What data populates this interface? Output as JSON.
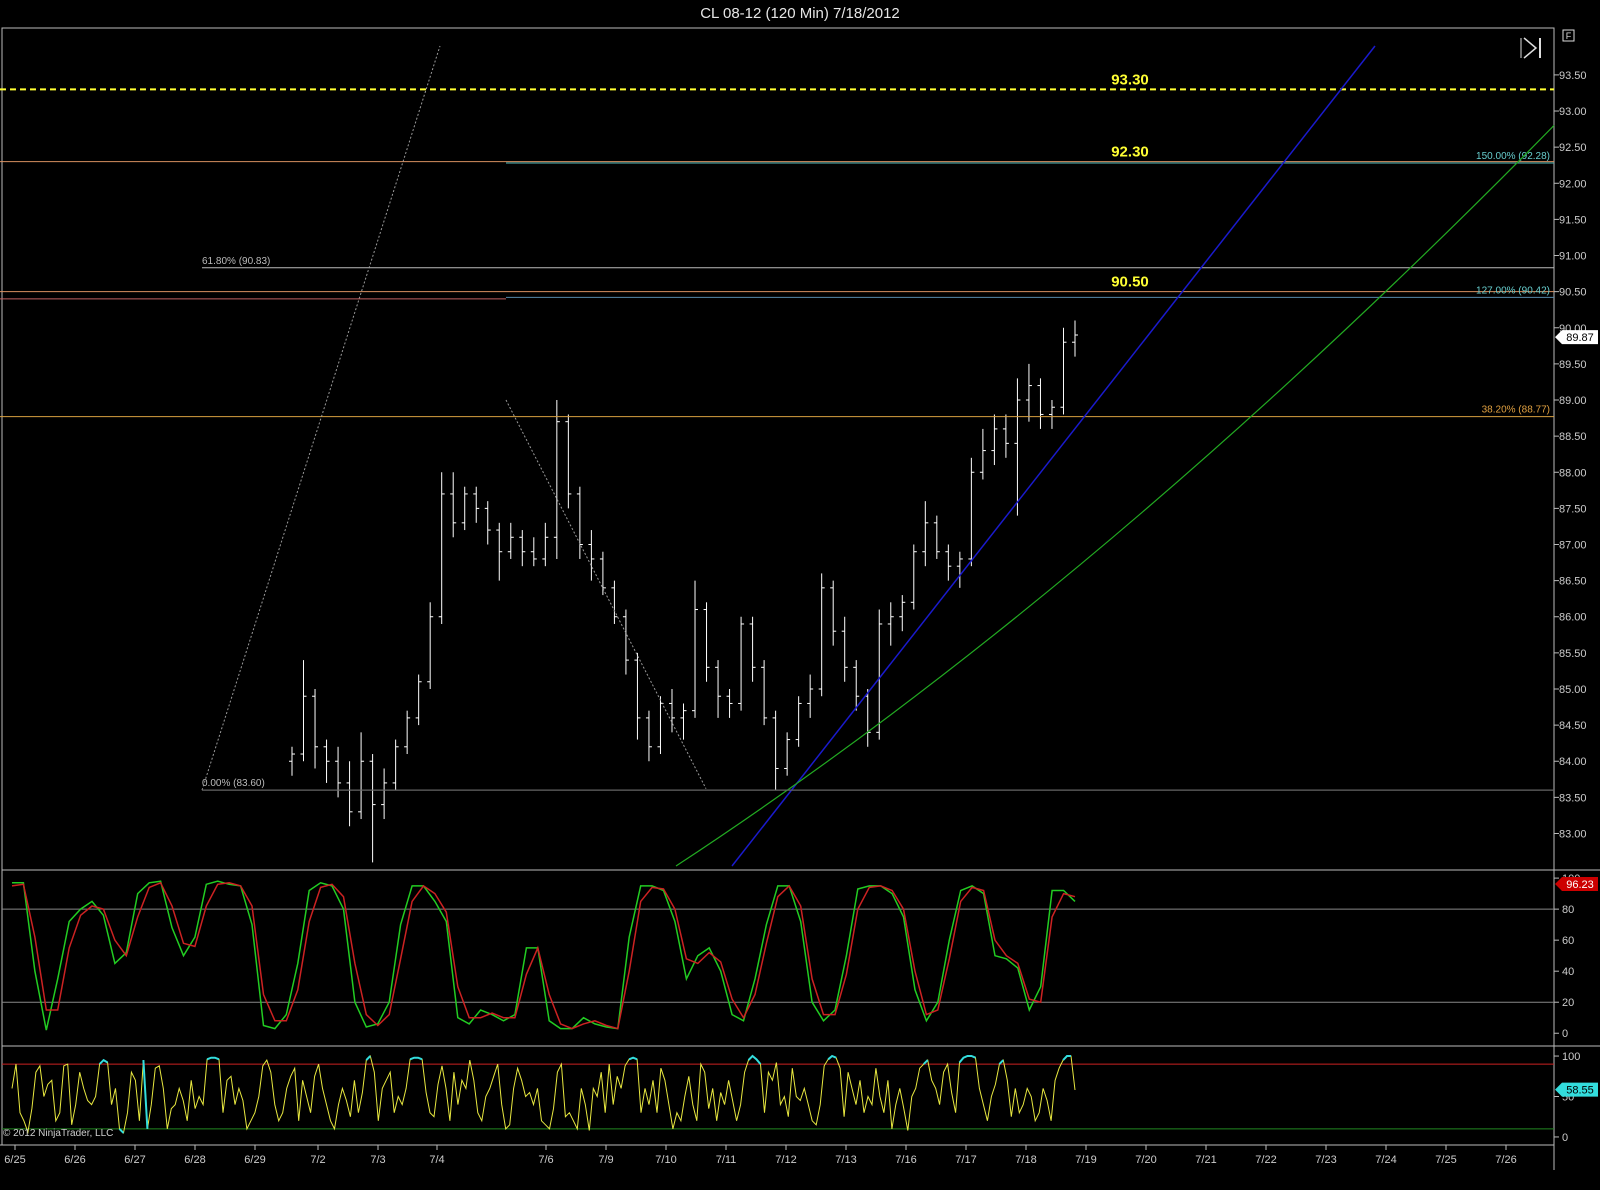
{
  "title": "CL 08-12 (120 Min)  7/18/2012",
  "copyright": "© 2012 NinjaTrader, LLC",
  "colors": {
    "background": "#000000",
    "grid": "#8a8a8a",
    "candles": "#ffffff",
    "yellow_level": "#ffff33",
    "fib_line": "#b0b0b0",
    "stoch_k": "#22cc22",
    "stoch_d": "#cc2222",
    "lower_line": "#e8e840",
    "lower_hi": "#33dddd",
    "blue_trend": "#1a1acc",
    "green_trend": "#22aa22",
    "price_marker": "#ffffff",
    "stoch_marker": "#cc0000",
    "lower_marker": "#33dddd"
  },
  "toolbar": {
    "icon": "scroll-end-icon",
    "f_label": "F"
  },
  "chart_data": [
    {
      "type": "candlestick",
      "title": "CL 08-12 (120 Min)  7/18/2012",
      "ylim": [
        82.55,
        93.9
      ],
      "yticks": [
        83.0,
        83.5,
        84.0,
        84.5,
        85.0,
        85.5,
        86.0,
        86.5,
        87.0,
        87.5,
        88.0,
        88.5,
        89.0,
        89.5,
        90.0,
        90.5,
        91.0,
        91.5,
        92.0,
        92.5,
        93.0,
        93.5
      ],
      "ytick_labels": [
        "83.00",
        "83.50",
        "84.00",
        "84.50",
        "85.00",
        "85.50",
        "86.00",
        "86.50",
        "87.00",
        "87.50",
        "88.00",
        "88.50",
        "89.00",
        "89.50",
        "90.00",
        "90.50",
        "91.00",
        "91.50",
        "92.00",
        "92.50",
        "93.00",
        "93.50"
      ],
      "last_price": "89.87",
      "last_price_value": 89.87,
      "levels": [
        {
          "value": 93.3,
          "label": "93.30",
          "style": "dashed"
        },
        {
          "value": 92.3,
          "label": "92.30",
          "style": "solid"
        },
        {
          "value": 90.5,
          "label": "90.50",
          "style": "solid"
        }
      ],
      "fib_labels": [
        {
          "value": 90.83,
          "label": "61.80% (90.83)"
        },
        {
          "value": 83.6,
          "label": "0.00% (83.60)"
        },
        {
          "value": 88.77,
          "label": "38.20% (88.77)"
        },
        {
          "value": 92.28,
          "label": "150.00% (92.28)"
        },
        {
          "value": 90.42,
          "label": "127.00% (90.42)"
        }
      ],
      "ohlc": [
        [
          84.0,
          84.2,
          83.8,
          84.1
        ],
        [
          84.1,
          85.4,
          84.0,
          84.9
        ],
        [
          84.9,
          85.0,
          83.9,
          84.2
        ],
        [
          84.2,
          84.3,
          83.7,
          84.0
        ],
        [
          84.0,
          84.2,
          83.5,
          83.7
        ],
        [
          83.7,
          84.0,
          83.1,
          83.3
        ],
        [
          83.3,
          84.4,
          83.2,
          84.0
        ],
        [
          84.0,
          84.1,
          82.6,
          83.4
        ],
        [
          83.4,
          83.9,
          83.2,
          83.7
        ],
        [
          83.7,
          84.3,
          83.6,
          84.2
        ],
        [
          84.2,
          84.7,
          84.1,
          84.6
        ],
        [
          84.6,
          85.2,
          84.5,
          85.1
        ],
        [
          85.1,
          86.2,
          85.0,
          86.0
        ],
        [
          86.0,
          88.0,
          85.9,
          87.7
        ],
        [
          87.7,
          88.0,
          87.1,
          87.3
        ],
        [
          87.3,
          87.8,
          87.2,
          87.7
        ],
        [
          87.7,
          87.8,
          87.3,
          87.5
        ],
        [
          87.5,
          87.6,
          87.0,
          87.2
        ],
        [
          87.2,
          87.3,
          86.5,
          86.9
        ],
        [
          86.9,
          87.3,
          86.8,
          87.1
        ],
        [
          87.1,
          87.2,
          86.7,
          86.9
        ],
        [
          86.9,
          87.1,
          86.7,
          86.8
        ],
        [
          86.8,
          87.3,
          86.7,
          87.1
        ],
        [
          87.1,
          89.0,
          86.8,
          88.7
        ],
        [
          88.7,
          88.8,
          87.5,
          87.7
        ],
        [
          87.7,
          87.8,
          86.8,
          87.0
        ],
        [
          87.0,
          87.2,
          86.5,
          86.8
        ],
        [
          86.8,
          86.9,
          86.3,
          86.4
        ],
        [
          86.4,
          86.5,
          85.9,
          86.0
        ],
        [
          86.0,
          86.1,
          85.2,
          85.4
        ],
        [
          85.4,
          85.5,
          84.3,
          84.6
        ],
        [
          84.6,
          84.7,
          84.0,
          84.2
        ],
        [
          84.2,
          84.9,
          84.1,
          84.8
        ],
        [
          84.8,
          85.0,
          84.4,
          84.6
        ],
        [
          84.6,
          84.8,
          84.3,
          84.7
        ],
        [
          84.7,
          86.5,
          84.6,
          86.1
        ],
        [
          86.1,
          86.2,
          85.1,
          85.3
        ],
        [
          85.3,
          85.4,
          84.6,
          84.9
        ],
        [
          84.9,
          85.0,
          84.6,
          84.8
        ],
        [
          84.8,
          86.0,
          84.7,
          85.9
        ],
        [
          85.9,
          86.0,
          85.1,
          85.3
        ],
        [
          85.3,
          85.4,
          84.5,
          84.6
        ],
        [
          84.6,
          84.7,
          83.6,
          83.9
        ],
        [
          83.9,
          84.4,
          83.8,
          84.3
        ],
        [
          84.3,
          84.9,
          84.2,
          84.8
        ],
        [
          84.8,
          85.2,
          84.6,
          85.0
        ],
        [
          85.0,
          86.6,
          84.9,
          86.4
        ],
        [
          86.4,
          86.5,
          85.6,
          85.8
        ],
        [
          85.8,
          86.0,
          85.1,
          85.3
        ],
        [
          85.3,
          85.4,
          84.7,
          84.9
        ],
        [
          84.9,
          85.0,
          84.2,
          84.4
        ],
        [
          84.4,
          86.1,
          84.3,
          85.9
        ],
        [
          85.9,
          86.2,
          85.6,
          86.0
        ],
        [
          86.0,
          86.3,
          85.8,
          86.2
        ],
        [
          86.2,
          87.0,
          86.1,
          86.9
        ],
        [
          86.9,
          87.6,
          86.7,
          87.3
        ],
        [
          87.3,
          87.4,
          86.8,
          86.9
        ],
        [
          86.9,
          87.0,
          86.5,
          86.7
        ],
        [
          86.7,
          86.9,
          86.4,
          86.8
        ],
        [
          86.8,
          88.2,
          86.7,
          88.0
        ],
        [
          88.0,
          88.6,
          87.9,
          88.3
        ],
        [
          88.3,
          88.8,
          88.1,
          88.6
        ],
        [
          88.6,
          88.8,
          88.2,
          88.4
        ],
        [
          88.4,
          89.3,
          87.4,
          89.0
        ],
        [
          89.0,
          89.5,
          88.7,
          89.2
        ],
        [
          89.2,
          89.3,
          88.6,
          88.8
        ],
        [
          88.8,
          89.0,
          88.6,
          88.9
        ],
        [
          88.9,
          90.0,
          88.8,
          89.8
        ],
        [
          89.8,
          90.1,
          89.6,
          89.9
        ]
      ]
    },
    {
      "type": "line",
      "ylim": [
        -5,
        102
      ],
      "yticks": [
        0,
        20,
        40,
        60,
        80,
        100
      ],
      "ytick_labels": [
        "0",
        "20",
        "40",
        "60",
        "80",
        "100"
      ],
      "hlines": [
        20,
        80
      ],
      "last_value": "96.23",
      "series": [
        {
          "values": [
            97,
            97,
            40,
            2,
            35,
            72,
            80,
            85,
            76,
            45,
            52,
            90,
            97,
            98,
            68,
            50,
            62,
            96,
            98,
            96,
            95,
            70,
            5,
            3,
            12,
            45,
            92,
            97,
            95,
            80,
            20,
            4,
            6,
            20,
            70,
            95,
            95,
            85,
            72,
            10,
            6,
            15,
            12,
            8,
            12,
            55,
            55,
            8,
            3,
            3,
            10,
            6,
            4,
            3,
            62,
            95,
            95,
            92,
            72,
            35,
            50,
            55,
            40,
            12,
            8,
            35,
            70,
            95,
            95,
            72,
            20,
            8,
            15,
            50,
            93,
            95,
            95,
            90,
            75,
            28,
            8,
            20,
            60,
            92,
            95,
            90,
            50,
            48,
            42,
            15,
            30,
            92,
            92,
            85
          ]
        },
        {
          "values": [
            95,
            96,
            62,
            15,
            15,
            55,
            76,
            82,
            80,
            60,
            50,
            75,
            94,
            97,
            82,
            58,
            56,
            82,
            96,
            97,
            95,
            82,
            25,
            8,
            8,
            28,
            72,
            94,
            96,
            88,
            45,
            12,
            5,
            12,
            48,
            85,
            95,
            90,
            78,
            30,
            10,
            10,
            13,
            10,
            10,
            38,
            55,
            25,
            6,
            3,
            6,
            8,
            5,
            3,
            40,
            85,
            94,
            93,
            80,
            48,
            45,
            52,
            46,
            22,
            10,
            25,
            58,
            88,
            95,
            82,
            35,
            12,
            12,
            38,
            80,
            94,
            95,
            92,
            80,
            40,
            12,
            15,
            48,
            85,
            94,
            92,
            60,
            50,
            45,
            22,
            20,
            75,
            90,
            88
          ]
        }
      ]
    },
    {
      "type": "line",
      "ylim": [
        -5,
        105
      ],
      "yticks": [
        0,
        50,
        100
      ],
      "ytick_labels": [
        "0",
        "50",
        "100"
      ],
      "hlines": [
        10,
        90
      ],
      "last_value": "58.55",
      "series": [
        {
          "values": [
            60,
            90,
            30,
            20,
            6,
            35,
            80,
            88,
            50,
            65,
            70,
            20,
            30,
            88,
            90,
            15,
            40,
            80,
            60,
            45,
            40,
            50,
            90,
            95,
            92,
            40,
            60,
            10,
            5,
            30,
            80,
            70,
            20,
            95,
            10,
            40,
            85,
            88,
            60,
            10,
            35,
            40,
            60,
            45,
            20,
            70,
            35,
            50,
            40,
            96,
            98,
            98,
            96,
            30,
            70,
            75,
            40,
            60,
            45,
            10,
            20,
            30,
            50,
            88,
            95,
            80,
            40,
            20,
            30,
            60,
            75,
            85,
            20,
            70,
            50,
            30,
            75,
            90,
            60,
            40,
            20,
            10,
            40,
            60,
            45,
            25,
            70,
            30,
            55,
            95,
            100,
            80,
            20,
            60,
            70,
            80,
            30,
            50,
            40,
            60,
            96,
            98,
            98,
            96,
            55,
            30,
            25,
            65,
            88,
            60,
            20,
            80,
            40,
            70,
            60,
            95,
            70,
            30,
            20,
            50,
            60,
            75,
            90,
            40,
            10,
            15,
            60,
            85,
            70,
            50,
            55,
            40,
            60,
            20,
            15,
            10,
            35,
            80,
            90,
            25,
            30,
            20,
            10,
            60,
            40,
            8,
            60,
            50,
            80,
            30,
            90,
            40,
            75,
            60,
            88,
            96,
            98,
            96,
            30,
            60,
            40,
            70,
            30,
            85,
            70,
            40,
            10,
            30,
            20,
            50,
            75,
            40,
            20,
            90,
            80,
            35,
            60,
            20,
            55,
            40,
            70,
            45,
            20,
            40,
            80,
            95,
            100,
            96,
            90,
            30,
            80,
            70,
            92,
            40,
            50,
            25,
            85,
            50,
            45,
            60,
            40,
            20,
            15,
            40,
            88,
            96,
            100,
            98,
            85,
            25,
            80,
            60,
            40,
            70,
            30,
            50,
            40,
            85,
            50,
            30,
            70,
            10,
            40,
            60,
            35,
            8,
            50,
            60,
            85,
            90,
            95,
            70,
            60,
            40,
            80,
            90,
            55,
            30,
            92,
            98,
            100,
            100,
            98,
            60,
            40,
            20,
            50,
            65,
            90,
            95,
            70,
            25,
            60,
            30,
            40,
            60,
            50,
            20,
            30,
            60,
            45,
            20,
            70,
            85,
            95,
            100,
            100,
            58
          ]
        }
      ]
    }
  ],
  "x_axis": {
    "labels": [
      "6/25",
      "6/26",
      "6/27",
      "6/28",
      "6/29",
      "7/2",
      "7/3",
      "7/4",
      "7/6",
      "7/9",
      "7/10",
      "7/11",
      "7/12",
      "7/13",
      "7/16",
      "7/17",
      "7/18",
      "7/19",
      "7/20",
      "7/21",
      "7/22",
      "7/23",
      "7/24",
      "7/25",
      "7/26"
    ]
  }
}
